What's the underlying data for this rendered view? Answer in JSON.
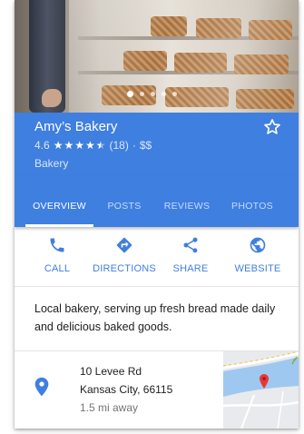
{
  "business": {
    "name": "Amy’s Bakery",
    "rating": "4.6",
    "review_count": "(18)",
    "separator": "·",
    "price": "$$",
    "category": "Bakery",
    "stars_value": 4.6
  },
  "photo": {
    "total": 5,
    "current": 1
  },
  "tabs": [
    {
      "label": "OVERVIEW",
      "active": true
    },
    {
      "label": "POSTS",
      "active": false
    },
    {
      "label": "REVIEWS",
      "active": false
    },
    {
      "label": "PHOTOS",
      "active": false
    }
  ],
  "actions": [
    {
      "label": "CALL",
      "icon": "phone-icon"
    },
    {
      "label": "DIRECTIONS",
      "icon": "directions-icon"
    },
    {
      "label": "SHARE",
      "icon": "share-icon"
    },
    {
      "label": "WEBSITE",
      "icon": "globe-icon"
    }
  ],
  "description": "Local bakery, serving up fresh bread made daily and delicious baked goods.",
  "address": {
    "street": "10 Levee Rd",
    "city_zip": "Kansas City, 66115",
    "distance": "1.5 mi away"
  },
  "colors": {
    "brand_blue": "#3f7fe0",
    "map_pin_red": "#e53935"
  }
}
